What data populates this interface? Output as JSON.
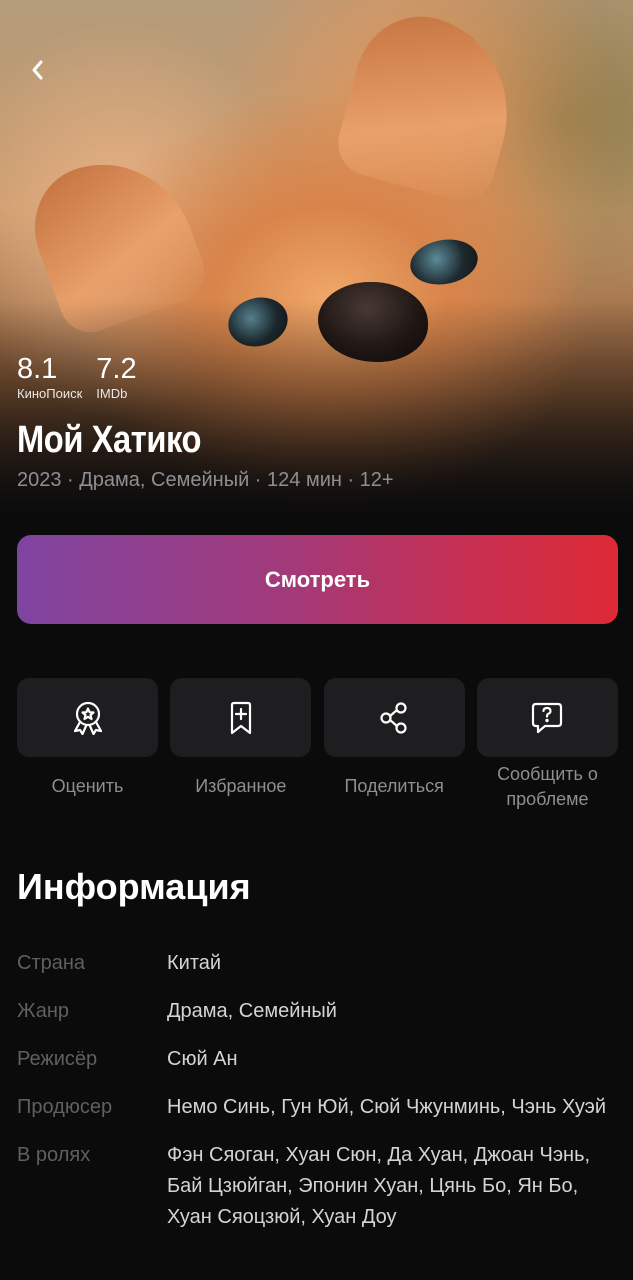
{
  "header": {
    "back_icon": "chevron-left-icon"
  },
  "ratings": [
    {
      "value": "8.1",
      "source": "КиноПоиск"
    },
    {
      "value": "7.2",
      "source": "IMDb"
    }
  ],
  "movie": {
    "title": "Мой Хатико",
    "meta": "2023 · Драма, Семейный · 124 мин · 12+"
  },
  "watch_button": {
    "label": "Смотреть"
  },
  "actions": [
    {
      "label": "Оценить",
      "icon": "award-icon"
    },
    {
      "label": "Избранное",
      "icon": "bookmark-add-icon"
    },
    {
      "label": "Поделиться",
      "icon": "share-icon"
    },
    {
      "label": "Сообщить о проблеме",
      "icon": "report-question-icon"
    }
  ],
  "info": {
    "title": "Информация",
    "rows": [
      {
        "key": "Страна",
        "value": "Китай"
      },
      {
        "key": "Жанр",
        "value": "Драма, Семейный"
      },
      {
        "key": "Режисёр",
        "value": "Сюй Ан"
      },
      {
        "key": "Продюсер",
        "value": "Немо Синь, Гун Юй, Сюй Чжунминь, Чэнь Хуэй"
      },
      {
        "key": "В ролях",
        "value": "Фэн Сяоган, Хуан Сюн, Да Хуан, Джоан Чэнь, Бай Цзюйган, Эпонин Хуан, Цянь Бо, Ян Бо, Хуан Сяоцзюй, Хуан Доу"
      }
    ]
  },
  "colors": {
    "background": "#0b0b0c",
    "button_gradient_start": "#7e44a0",
    "button_gradient_end": "#dd2a34",
    "tile": "#1e1e20",
    "muted_text": "#8e8e93"
  }
}
